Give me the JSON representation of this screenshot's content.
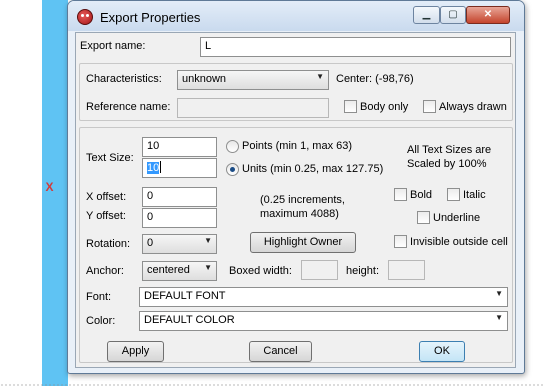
{
  "window": {
    "title": "Export Properties",
    "min_glyph": "▁",
    "max_glyph": "▢",
    "close_glyph": "✕"
  },
  "background_marker": "X",
  "export_name": {
    "label": "Export name:",
    "value": "L"
  },
  "characteristics": {
    "label": "Characteristics:",
    "value": "unknown",
    "center_text": "Center: (-98,76)"
  },
  "reference_name": {
    "label": "Reference name:",
    "value": ""
  },
  "body_only": {
    "label": "Body only",
    "checked": false
  },
  "always_drawn": {
    "label": "Always drawn",
    "checked": false
  },
  "text_size": {
    "label": "Text Size:",
    "points_value": "10",
    "units_value": "10",
    "points_label": "Points (min 1, max 63)",
    "units_label": "Units (min 0.25, max 127.75)",
    "selected": "units",
    "scale_note_1": "All Text Sizes are",
    "scale_note_2": "Scaled by 100%"
  },
  "x_offset": {
    "label": "X offset:",
    "value": "0"
  },
  "y_offset": {
    "label": "Y offset:",
    "value": "0"
  },
  "increments_note_1": "(0.25 increments,",
  "increments_note_2": "maximum 4088)",
  "bold": {
    "label": "Bold",
    "checked": false
  },
  "italic": {
    "label": "Italic",
    "checked": false
  },
  "underline": {
    "label": "Underline",
    "checked": false
  },
  "rotation": {
    "label": "Rotation:",
    "value": "0"
  },
  "highlight_owner_label": "Highlight Owner",
  "invisible_outside_cell": {
    "label": "Invisible outside cell",
    "checked": false
  },
  "anchor": {
    "label": "Anchor:",
    "value": "centered"
  },
  "boxed_width": {
    "label": "Boxed width:",
    "value": ""
  },
  "height": {
    "label": "height:",
    "value": ""
  },
  "font": {
    "label": "Font:",
    "value": "DEFAULT FONT"
  },
  "color": {
    "label": "Color:",
    "value": "DEFAULT COLOR"
  },
  "buttons": {
    "apply": "Apply",
    "cancel": "Cancel",
    "ok": "OK"
  }
}
